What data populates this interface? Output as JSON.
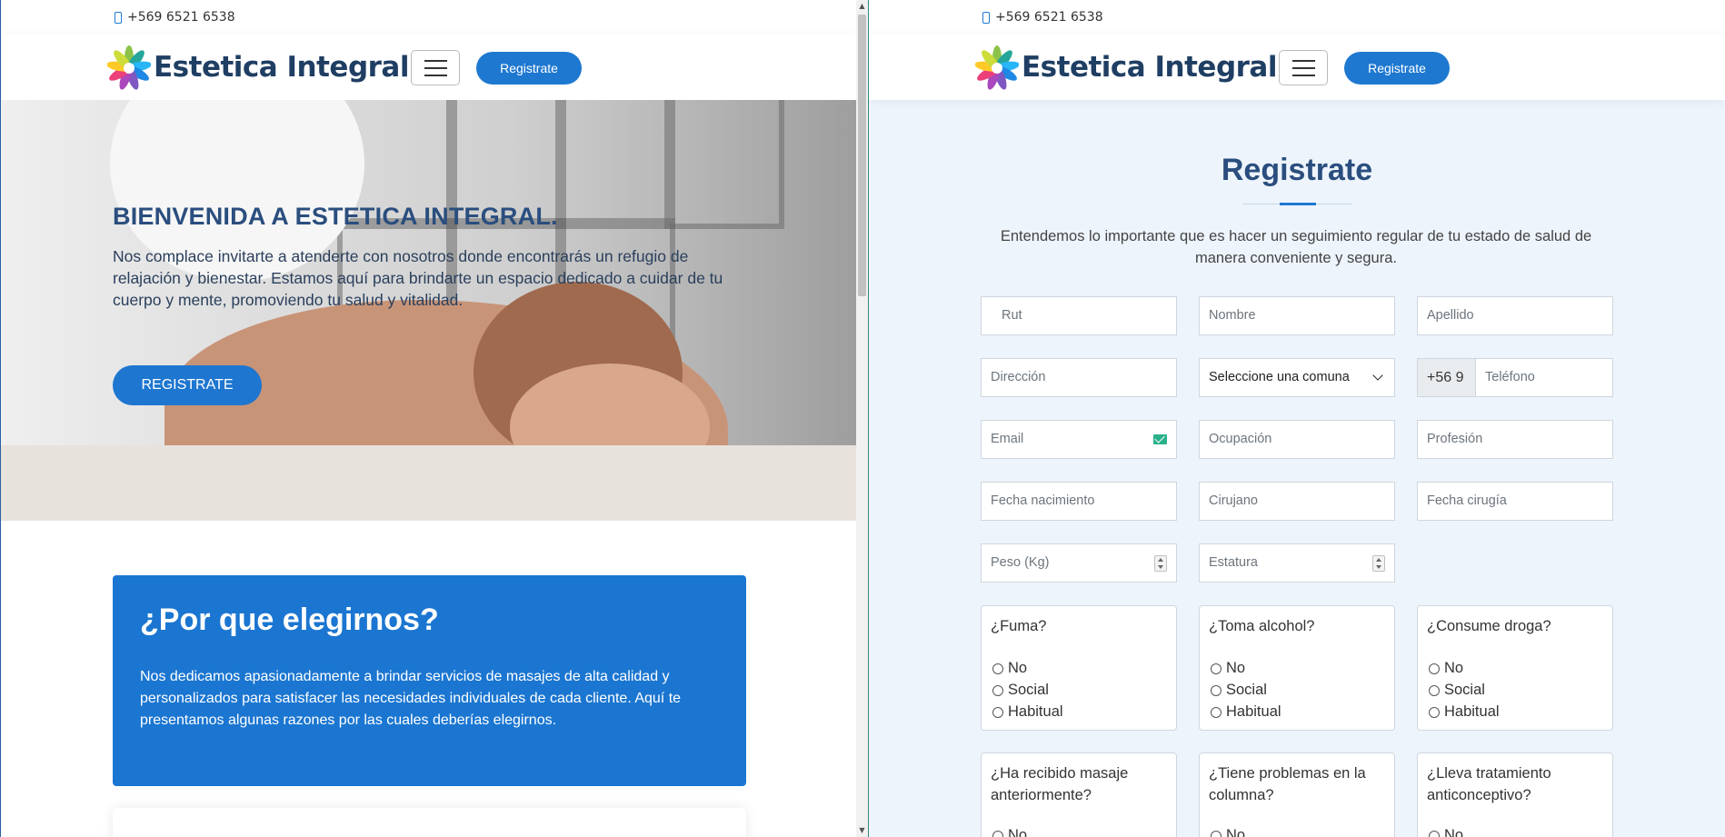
{
  "left": {
    "topbar": {
      "phone": "+569 6521 6538"
    },
    "navbar": {
      "brand": "Estetica Integral",
      "register_label": "Registrate"
    },
    "hero": {
      "heading": "BIENVENIDA A ESTETICA INTEGRAL.",
      "text": "Nos complace invitarte a atenderte con nosotros donde encontrarás un refugio de relajación y bienestar. Estamos aquí para brindarte un espacio dedicado a cuidar de tu cuerpo y mente, promoviendo tu salud y vitalidad.",
      "cta": "REGISTRATE"
    },
    "why": {
      "heading": "¿Por que elegirnos?",
      "text": "Nos dedicamos apasionadamente a brindar servicios de masajes de alta calidad y personalizados para satisfacer las necesidades individuales de cada cliente. Aquí te presentamos algunas razones por las cuales deberías elegirnos."
    }
  },
  "right": {
    "topbar": {
      "phone": "+569 6521 6538"
    },
    "navbar": {
      "brand": "Estetica Integral",
      "register_label": "Registrate"
    },
    "form": {
      "title": "Registrate",
      "subtitle": "Entendemos lo importante que es hacer un seguimiento regular de tu estado de salud de manera conveniente y segura.",
      "placeholders": {
        "rut": "Rut",
        "nombre": "Nombre",
        "apellido": "Apellido",
        "direccion": "Dirección",
        "comuna": "Seleccione una comuna",
        "phone_prefix": "+56 9",
        "telefono": "Teléfono",
        "email": "Email",
        "ocupacion": "Ocupación",
        "profesion": "Profesión",
        "fecha_nacimiento": "Fecha nacimiento",
        "cirujano": "Cirujano",
        "fecha_cirugia": "Fecha cirugía",
        "peso": "Peso (Kg)",
        "estatura": "Estatura"
      },
      "questions": [
        {
          "label": "¿Fuma?",
          "options": [
            "No",
            "Social",
            "Habitual"
          ]
        },
        {
          "label": "¿Toma alcohol?",
          "options": [
            "No",
            "Social",
            "Habitual"
          ]
        },
        {
          "label": "¿Consume droga?",
          "options": [
            "No",
            "Social",
            "Habitual"
          ]
        },
        {
          "label": "¿Ha recibido masaje anteriormente?",
          "options": [
            "No"
          ]
        },
        {
          "label": "¿Tiene problemas en la columna?",
          "options": [
            "No"
          ]
        },
        {
          "label": "¿Lleva tratamiento anticonceptivo?",
          "options": [
            "No"
          ]
        }
      ]
    }
  },
  "colors": {
    "primary": "#1e78d0",
    "heading": "#2a4e7e",
    "brand_text": "#1f3e63",
    "form_bg": "#eef4fc"
  }
}
